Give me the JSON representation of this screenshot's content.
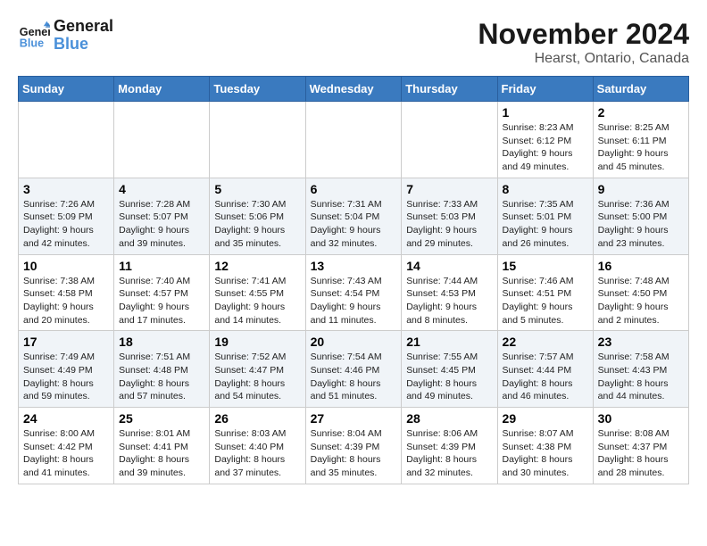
{
  "logo": {
    "general": "General",
    "blue": "Blue"
  },
  "title": {
    "month": "November 2024",
    "location": "Hearst, Ontario, Canada"
  },
  "weekdays": [
    "Sunday",
    "Monday",
    "Tuesday",
    "Wednesday",
    "Thursday",
    "Friday",
    "Saturday"
  ],
  "weeks": [
    [
      {
        "day": "",
        "info": ""
      },
      {
        "day": "",
        "info": ""
      },
      {
        "day": "",
        "info": ""
      },
      {
        "day": "",
        "info": ""
      },
      {
        "day": "",
        "info": ""
      },
      {
        "day": "1",
        "info": "Sunrise: 8:23 AM\nSunset: 6:12 PM\nDaylight: 9 hours and 49 minutes."
      },
      {
        "day": "2",
        "info": "Sunrise: 8:25 AM\nSunset: 6:11 PM\nDaylight: 9 hours and 45 minutes."
      }
    ],
    [
      {
        "day": "3",
        "info": "Sunrise: 7:26 AM\nSunset: 5:09 PM\nDaylight: 9 hours and 42 minutes."
      },
      {
        "day": "4",
        "info": "Sunrise: 7:28 AM\nSunset: 5:07 PM\nDaylight: 9 hours and 39 minutes."
      },
      {
        "day": "5",
        "info": "Sunrise: 7:30 AM\nSunset: 5:06 PM\nDaylight: 9 hours and 35 minutes."
      },
      {
        "day": "6",
        "info": "Sunrise: 7:31 AM\nSunset: 5:04 PM\nDaylight: 9 hours and 32 minutes."
      },
      {
        "day": "7",
        "info": "Sunrise: 7:33 AM\nSunset: 5:03 PM\nDaylight: 9 hours and 29 minutes."
      },
      {
        "day": "8",
        "info": "Sunrise: 7:35 AM\nSunset: 5:01 PM\nDaylight: 9 hours and 26 minutes."
      },
      {
        "day": "9",
        "info": "Sunrise: 7:36 AM\nSunset: 5:00 PM\nDaylight: 9 hours and 23 minutes."
      }
    ],
    [
      {
        "day": "10",
        "info": "Sunrise: 7:38 AM\nSunset: 4:58 PM\nDaylight: 9 hours and 20 minutes."
      },
      {
        "day": "11",
        "info": "Sunrise: 7:40 AM\nSunset: 4:57 PM\nDaylight: 9 hours and 17 minutes."
      },
      {
        "day": "12",
        "info": "Sunrise: 7:41 AM\nSunset: 4:55 PM\nDaylight: 9 hours and 14 minutes."
      },
      {
        "day": "13",
        "info": "Sunrise: 7:43 AM\nSunset: 4:54 PM\nDaylight: 9 hours and 11 minutes."
      },
      {
        "day": "14",
        "info": "Sunrise: 7:44 AM\nSunset: 4:53 PM\nDaylight: 9 hours and 8 minutes."
      },
      {
        "day": "15",
        "info": "Sunrise: 7:46 AM\nSunset: 4:51 PM\nDaylight: 9 hours and 5 minutes."
      },
      {
        "day": "16",
        "info": "Sunrise: 7:48 AM\nSunset: 4:50 PM\nDaylight: 9 hours and 2 minutes."
      }
    ],
    [
      {
        "day": "17",
        "info": "Sunrise: 7:49 AM\nSunset: 4:49 PM\nDaylight: 8 hours and 59 minutes."
      },
      {
        "day": "18",
        "info": "Sunrise: 7:51 AM\nSunset: 4:48 PM\nDaylight: 8 hours and 57 minutes."
      },
      {
        "day": "19",
        "info": "Sunrise: 7:52 AM\nSunset: 4:47 PM\nDaylight: 8 hours and 54 minutes."
      },
      {
        "day": "20",
        "info": "Sunrise: 7:54 AM\nSunset: 4:46 PM\nDaylight: 8 hours and 51 minutes."
      },
      {
        "day": "21",
        "info": "Sunrise: 7:55 AM\nSunset: 4:45 PM\nDaylight: 8 hours and 49 minutes."
      },
      {
        "day": "22",
        "info": "Sunrise: 7:57 AM\nSunset: 4:44 PM\nDaylight: 8 hours and 46 minutes."
      },
      {
        "day": "23",
        "info": "Sunrise: 7:58 AM\nSunset: 4:43 PM\nDaylight: 8 hours and 44 minutes."
      }
    ],
    [
      {
        "day": "24",
        "info": "Sunrise: 8:00 AM\nSunset: 4:42 PM\nDaylight: 8 hours and 41 minutes."
      },
      {
        "day": "25",
        "info": "Sunrise: 8:01 AM\nSunset: 4:41 PM\nDaylight: 8 hours and 39 minutes."
      },
      {
        "day": "26",
        "info": "Sunrise: 8:03 AM\nSunset: 4:40 PM\nDaylight: 8 hours and 37 minutes."
      },
      {
        "day": "27",
        "info": "Sunrise: 8:04 AM\nSunset: 4:39 PM\nDaylight: 8 hours and 35 minutes."
      },
      {
        "day": "28",
        "info": "Sunrise: 8:06 AM\nSunset: 4:39 PM\nDaylight: 8 hours and 32 minutes."
      },
      {
        "day": "29",
        "info": "Sunrise: 8:07 AM\nSunset: 4:38 PM\nDaylight: 8 hours and 30 minutes."
      },
      {
        "day": "30",
        "info": "Sunrise: 8:08 AM\nSunset: 4:37 PM\nDaylight: 8 hours and 28 minutes."
      }
    ]
  ]
}
